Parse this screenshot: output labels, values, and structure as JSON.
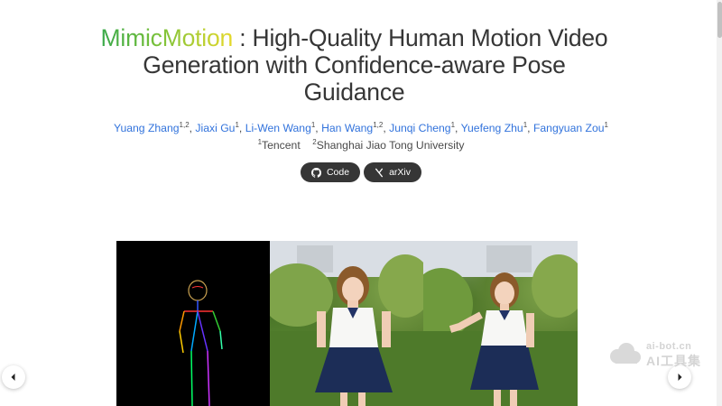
{
  "title": {
    "brand": "MimicMotion",
    "rest": " : High-Quality Human Motion Video Generation with Confidence-aware Pose Guidance"
  },
  "authors": [
    {
      "name": "Yuang Zhang",
      "aff": "1,2"
    },
    {
      "name": "Jiaxi Gu",
      "aff": "1"
    },
    {
      "name": "Li-Wen Wang",
      "aff": "1"
    },
    {
      "name": "Han Wang",
      "aff": "1,2"
    },
    {
      "name": "Junqi Cheng",
      "aff": "1"
    },
    {
      "name": "Yuefeng Zhu",
      "aff": "1"
    },
    {
      "name": "Fangyuan Zou",
      "aff": "1"
    }
  ],
  "affiliations": [
    {
      "num": "1",
      "name": "Tencent"
    },
    {
      "num": "2",
      "name": "Shanghai Jiao Tong University"
    }
  ],
  "buttons": {
    "code": {
      "label": "Code",
      "icon": "github-icon"
    },
    "arxiv": {
      "label": "arXiv",
      "icon": "arxiv-icon"
    }
  },
  "watermark": {
    "line1": "ai-bot.cn",
    "line2": "AI工具集"
  },
  "colors": {
    "link": "#3273dc",
    "button_bg": "#363636",
    "text": "#363636"
  }
}
